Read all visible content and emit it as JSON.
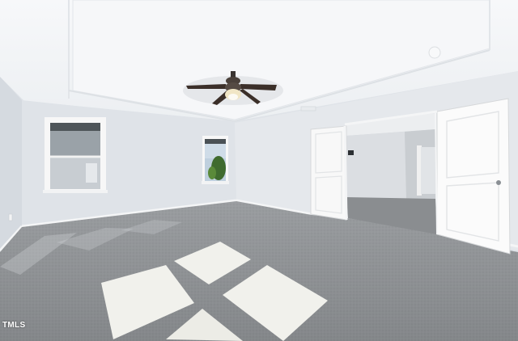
{
  "watermark": {
    "text": "TMLS"
  },
  "palette": {
    "ceiling": "#f4f6f8",
    "wall_left": "#d8dde3",
    "wall_back": "#e1e5ea",
    "wall_right": "#e6e9ed",
    "carpet": "#8e9194",
    "door": "#fbfbfb",
    "baseboard": "#f5f5f5",
    "sunlight": "#f3f3ee"
  },
  "scene_objects": {
    "ceiling_fan": "ceiling-fan-icon",
    "doors": "double-door",
    "windows": "window"
  }
}
